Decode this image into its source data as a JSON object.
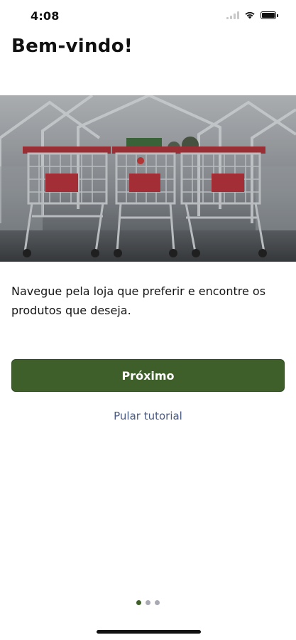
{
  "status_bar": {
    "time": "4:08",
    "icons": [
      "signal-icon",
      "wifi-icon",
      "battery-icon"
    ]
  },
  "onboarding": {
    "title": "Bem-vindo!",
    "image": "shopping-carts-photo",
    "description": "Navegue pela loja que preferir e encontre os produtos que deseja.",
    "next_label": "Próximo",
    "skip_label": "Pular tutorial"
  },
  "pagination": {
    "total": 3,
    "current": 1
  },
  "colors": {
    "primary": "#3e5f2a",
    "link": "#4a5a80",
    "dot_inactive": "#a9a9b4"
  }
}
